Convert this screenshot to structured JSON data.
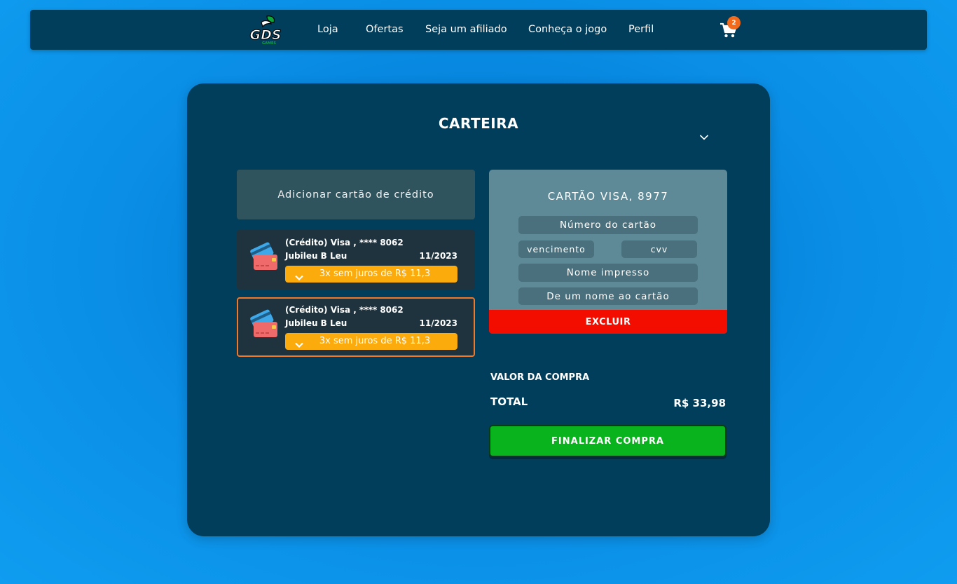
{
  "nav": {
    "logo_text": "GDS",
    "logo_subtext": "GAMES",
    "links": [
      "Loja",
      "Ofertas",
      "Seja um afiliado",
      "Conheça o jogo",
      "Perfil"
    ],
    "cart_count": "2"
  },
  "wallet": {
    "title": "CARTEIRA",
    "add_card_label": "Adicionar cartão de crédito",
    "cards": [
      {
        "title": "(Crédito) Visa , **** 8062",
        "holder": "Jubileu B Leu",
        "expiry": "11/2023",
        "installment": "3x sem juros de R$ 11,3",
        "selected": false
      },
      {
        "title": "(Crédito) Visa , **** 8062",
        "holder": "Jubileu B Leu",
        "expiry": "11/2023",
        "installment": "3x sem juros de R$ 11,3",
        "selected": true
      }
    ]
  },
  "edit_card": {
    "title": "CARTÃO VISA, 8977",
    "number_placeholder": "Número do cartão",
    "expiry_placeholder": "vencimento",
    "cvv_placeholder": "cvv",
    "name_placeholder": "Nome impresso",
    "nickname_placeholder": "De um nome ao cartão",
    "delete_label": "EXCLUIR"
  },
  "summary": {
    "purchase_label": "VALOR DA COMPRA",
    "total_label": "TOTAL",
    "total_value": "R$ 33,98",
    "finalize_label": "FINALIZAR COMPRA"
  },
  "colors": {
    "navbar": "#013e5c",
    "accent_orange": "#f26a1b",
    "installment": "#fbab0b",
    "delete": "#f20d00",
    "finalize": "#09b31d"
  }
}
